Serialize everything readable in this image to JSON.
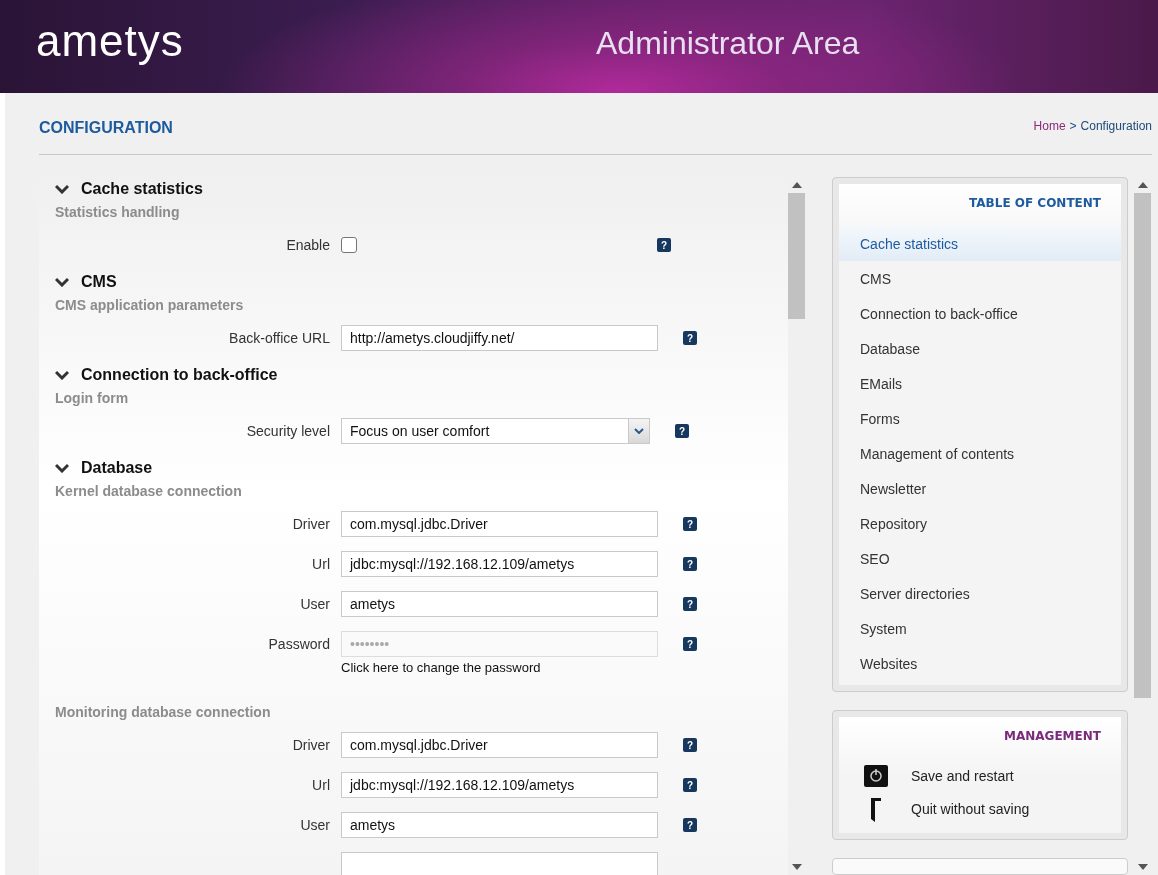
{
  "header": {
    "logo": "ametys",
    "title": "Administrator Area"
  },
  "page": {
    "title": "CONFIGURATION",
    "breadcrumb": [
      {
        "label": "Home",
        "kind": "link"
      },
      {
        "label": ">",
        "kind": "separator"
      },
      {
        "label": "Configuration",
        "kind": "current"
      }
    ]
  },
  "sections": [
    {
      "title": "Cache statistics",
      "expanded": true,
      "groups": [
        {
          "title": "Statistics handling",
          "fields": [
            {
              "kind": "checkbox",
              "label": "Enable",
              "checked": false,
              "help": "?"
            }
          ]
        }
      ]
    },
    {
      "title": "CMS",
      "expanded": true,
      "groups": [
        {
          "title": "CMS application parameters",
          "fields": [
            {
              "kind": "text",
              "label": "Back-office URL",
              "value": "http://ametys.cloudjiffy.net/",
              "help": "?"
            }
          ]
        }
      ]
    },
    {
      "title": "Connection to back-office",
      "expanded": true,
      "groups": [
        {
          "title": "Login form",
          "fields": [
            {
              "kind": "select",
              "label": "Security level",
              "value": "Focus on user comfort",
              "help": "?"
            }
          ]
        }
      ]
    },
    {
      "title": "Database",
      "expanded": true,
      "groups": [
        {
          "title": "Kernel database connection",
          "fields": [
            {
              "kind": "text",
              "label": "Driver",
              "value": "com.mysql.jdbc.Driver",
              "help": "?"
            },
            {
              "kind": "text",
              "label": "Url",
              "value": "jdbc:mysql://192.168.12.109/ametys",
              "help": "?"
            },
            {
              "kind": "text",
              "label": "User",
              "value": "ametys",
              "help": "?"
            },
            {
              "kind": "password",
              "label": "Password",
              "value": "••••••••",
              "help": "?",
              "link": "Click here to change the password"
            }
          ]
        },
        {
          "title": "Monitoring database connection",
          "fields": [
            {
              "kind": "text",
              "label": "Driver",
              "value": "com.mysql.jdbc.Driver",
              "help": "?"
            },
            {
              "kind": "text",
              "label": "Url",
              "value": "jdbc:mysql://192.168.12.109/ametys",
              "help": "?"
            },
            {
              "kind": "text",
              "label": "User",
              "value": "ametys",
              "help": "?"
            },
            {
              "kind": "partial"
            }
          ]
        }
      ]
    }
  ],
  "toc": {
    "title": "TABLE OF CONTENT",
    "items": [
      {
        "label": "Cache statistics",
        "selected": true
      },
      {
        "label": "CMS",
        "selected": false
      },
      {
        "label": "Connection to back-office",
        "selected": false
      },
      {
        "label": "Database",
        "selected": false
      },
      {
        "label": "EMails",
        "selected": false
      },
      {
        "label": "Forms",
        "selected": false
      },
      {
        "label": "Management of contents",
        "selected": false
      },
      {
        "label": "Newsletter",
        "selected": false
      },
      {
        "label": "Repository",
        "selected": false
      },
      {
        "label": "SEO",
        "selected": false
      },
      {
        "label": "Server directories",
        "selected": false
      },
      {
        "label": "System",
        "selected": false
      },
      {
        "label": "Websites",
        "selected": false
      }
    ]
  },
  "management": {
    "title": "MANAGEMENT",
    "actions": [
      {
        "kind": "save",
        "label": "Save and restart"
      },
      {
        "kind": "quit",
        "label": "Quit without saving"
      }
    ]
  }
}
